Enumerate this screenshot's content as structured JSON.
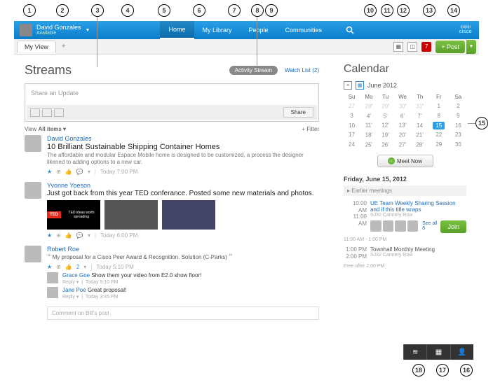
{
  "header": {
    "user_name": "David Gonzales",
    "user_status": "Available",
    "nav": {
      "home": "Home",
      "library": "My Library",
      "people": "People",
      "communities": "Communities"
    },
    "logo": "cisco"
  },
  "subheader": {
    "tab_myview": "My View",
    "notify_count": "7",
    "post_label": "+ Post"
  },
  "streams": {
    "title": "Streams",
    "pill": "Activity Stream",
    "watch_list": "Watch List (2)",
    "update_placeholder": "Share an Update",
    "share": "Share",
    "view_label": "View",
    "all_items": "All items",
    "filter": "+ Filter"
  },
  "posts": {
    "p1": {
      "author": "David Gonzales",
      "title": "10 Brilliant Sustainable Shipping Container Homes",
      "text": "The affordable and modular Espace Mobile home is designed to be customized, a process the designer likened to adding options to a new car.",
      "time": "Today 7:00 PM"
    },
    "p2": {
      "author": "Yvonne Yoeson",
      "title": "Just got back from this year TED conferance. Posted some new materials and photos.",
      "thumb1": "TED ideas worth spreading",
      "time": "Today 6:00 PM"
    },
    "p3": {
      "author": "Robert Roe",
      "text": "My proposal for a Cisco Peer Award & Recognition. Solution (C-Parks)",
      "like_count": "2",
      "time": "Today 5:10 PM",
      "r1_author": "Grace Goe",
      "r1_text": "Show them your video from E2.0 show floor!",
      "r1_time": "Today 5:10 PM",
      "r2_author": "Jane Poe",
      "r2_text": "Great proposal!",
      "r2_time": "Today 3:45 PM",
      "comment_placeholder": "Comment on Bill's post"
    }
  },
  "calendar": {
    "title": "Calendar",
    "month": "June 2012",
    "dow": {
      "su": "Su",
      "mo": "Mo",
      "tu": "Tu",
      "we": "We",
      "th": "Th",
      "fr": "Fr",
      "sa": "Sa"
    },
    "w1": {
      "d1": "27",
      "d2": "28",
      "d3": "29",
      "d4": "30",
      "d5": "31",
      "d6": "1",
      "d7": "2"
    },
    "w2": {
      "d1": "3",
      "d2": "4",
      "d3": "5",
      "d4": "6",
      "d5": "7",
      "d6": "8",
      "d7": "9"
    },
    "w3": {
      "d1": "10",
      "d2": "11",
      "d3": "12",
      "d4": "13",
      "d5": "14",
      "d6": "15",
      "d7": "16"
    },
    "w4": {
      "d1": "17",
      "d2": "18",
      "d3": "19",
      "d4": "20",
      "d5": "21",
      "d6": "22",
      "d7": "23"
    },
    "w5": {
      "d1": "24",
      "d2": "25",
      "d3": "26",
      "d4": "27",
      "d5": "28",
      "d6": "29",
      "d7": "30"
    },
    "meet_now": "Meet Now",
    "agenda_date": "Friday, June 15, 2012",
    "earlier": "Earlier meetings",
    "ev1_time1": "10:00 AM",
    "ev1_time2": "11:00 AM",
    "ev1_title": "UE Team Weekly Sharing Session and if this title wraps",
    "ev1_loc": "SJ32 Cannery Row",
    "see_all": "See all 8",
    "join": "Join",
    "slot1": "11:00 AM - 1:00 PM",
    "ev2_time1": "1:00 PM",
    "ev2_time2": "2:00 PM",
    "ev2_title": "Townhall Monthly Meeting",
    "ev2_loc": "SJ32 Cannery Row",
    "free_after": "Free after 2:00 PM"
  }
}
